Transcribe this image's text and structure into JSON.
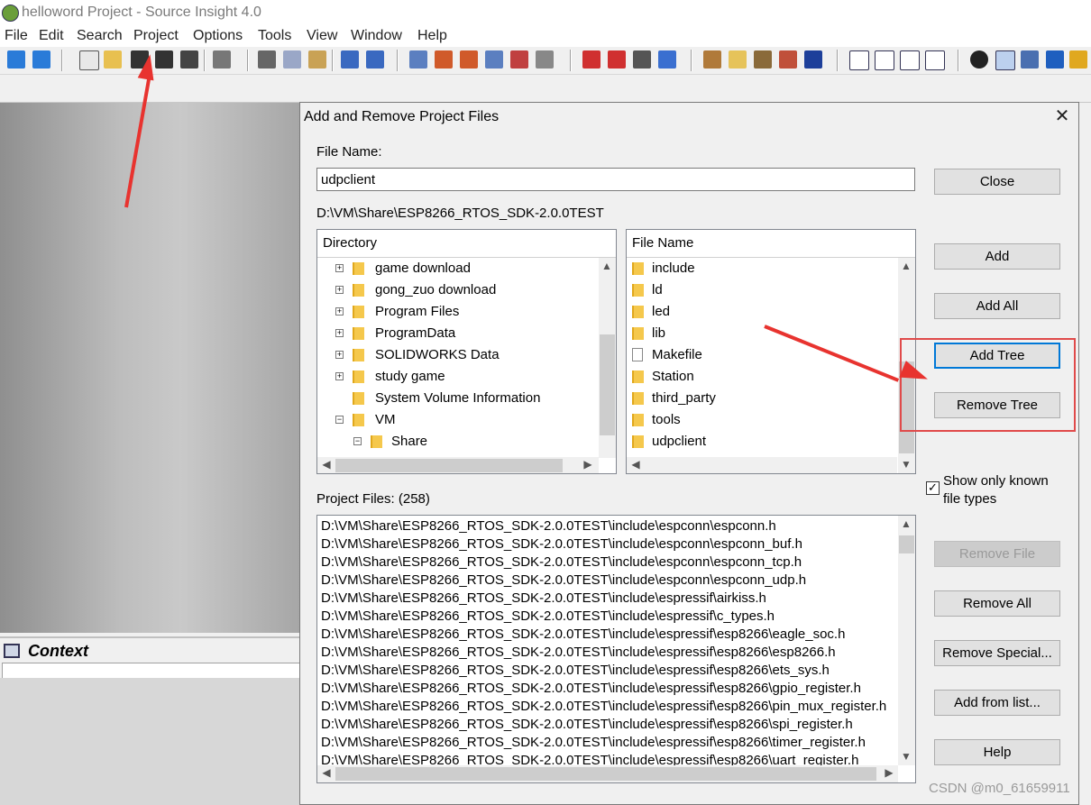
{
  "window": {
    "title": "helloword Project - Source Insight 4.0"
  },
  "menu": [
    "File",
    "Edit",
    "Search",
    "Project",
    "Options",
    "Tools",
    "View",
    "Window",
    "Help"
  ],
  "context_panel": {
    "title": "Context"
  },
  "dialog": {
    "title": "Add and Remove Project Files",
    "close_glyph": "✕",
    "file_name_label": "File Name:",
    "file_name_value": "udpclient",
    "current_path": "D:\\VM\\Share\\ESP8266_RTOS_SDK-2.0.0TEST",
    "directory_header": "Directory",
    "directory_items": [
      {
        "label": "game download",
        "expandable": true
      },
      {
        "label": "gong_zuo download",
        "expandable": true
      },
      {
        "label": "Program Files",
        "expandable": true
      },
      {
        "label": "ProgramData",
        "expandable": true
      },
      {
        "label": "SOLIDWORKS Data",
        "expandable": true
      },
      {
        "label": "study game",
        "expandable": true
      },
      {
        "label": "System Volume Information",
        "expandable": false
      },
      {
        "label": "VM",
        "expandable": true,
        "expanded": true
      },
      {
        "label": "Share",
        "expandable": true,
        "expanded": true,
        "indent": 1
      }
    ],
    "filename_header": "File Name",
    "file_items": [
      {
        "label": "include",
        "icon": "folder"
      },
      {
        "label": "ld",
        "icon": "folder"
      },
      {
        "label": "led",
        "icon": "folder"
      },
      {
        "label": "lib",
        "icon": "folder"
      },
      {
        "label": "Makefile",
        "icon": "file"
      },
      {
        "label": "Station",
        "icon": "folder"
      },
      {
        "label": "third_party",
        "icon": "folder"
      },
      {
        "label": "tools",
        "icon": "folder"
      },
      {
        "label": "udpclient",
        "icon": "folder"
      }
    ],
    "buttons": {
      "close": "Close",
      "add": "Add",
      "add_all": "Add All",
      "add_tree": "Add Tree",
      "remove_tree": "Remove Tree",
      "remove_file": "Remove File",
      "remove_all": "Remove All",
      "remove_special": "Remove Special...",
      "add_from_list": "Add from list...",
      "help": "Help"
    },
    "show_known_label": "Show only known file types",
    "show_known_checked": true,
    "project_files_label": "Project Files: (258)",
    "project_files": [
      "D:\\VM\\Share\\ESP8266_RTOS_SDK-2.0.0TEST\\include\\espconn\\espconn.h",
      "D:\\VM\\Share\\ESP8266_RTOS_SDK-2.0.0TEST\\include\\espconn\\espconn_buf.h",
      "D:\\VM\\Share\\ESP8266_RTOS_SDK-2.0.0TEST\\include\\espconn\\espconn_tcp.h",
      "D:\\VM\\Share\\ESP8266_RTOS_SDK-2.0.0TEST\\include\\espconn\\espconn_udp.h",
      "D:\\VM\\Share\\ESP8266_RTOS_SDK-2.0.0TEST\\include\\espressif\\airkiss.h",
      "D:\\VM\\Share\\ESP8266_RTOS_SDK-2.0.0TEST\\include\\espressif\\c_types.h",
      "D:\\VM\\Share\\ESP8266_RTOS_SDK-2.0.0TEST\\include\\espressif\\esp8266\\eagle_soc.h",
      "D:\\VM\\Share\\ESP8266_RTOS_SDK-2.0.0TEST\\include\\espressif\\esp8266\\esp8266.h",
      "D:\\VM\\Share\\ESP8266_RTOS_SDK-2.0.0TEST\\include\\espressif\\esp8266\\ets_sys.h",
      "D:\\VM\\Share\\ESP8266_RTOS_SDK-2.0.0TEST\\include\\espressif\\esp8266\\gpio_register.h",
      "D:\\VM\\Share\\ESP8266_RTOS_SDK-2.0.0TEST\\include\\espressif\\esp8266\\pin_mux_register.h",
      "D:\\VM\\Share\\ESP8266_RTOS_SDK-2.0.0TEST\\include\\espressif\\esp8266\\spi_register.h",
      "D:\\VM\\Share\\ESP8266_RTOS_SDK-2.0.0TEST\\include\\espressif\\esp8266\\timer_register.h",
      "D:\\VM\\Share\\ESP8266_RTOS_SDK-2.0.0TEST\\include\\espressif\\esp8266\\uart_register.h"
    ]
  },
  "watermark": "CSDN @m0_61659911",
  "colors": {
    "annotation_red": "#e8332f",
    "focus_blue": "#0078d7"
  }
}
